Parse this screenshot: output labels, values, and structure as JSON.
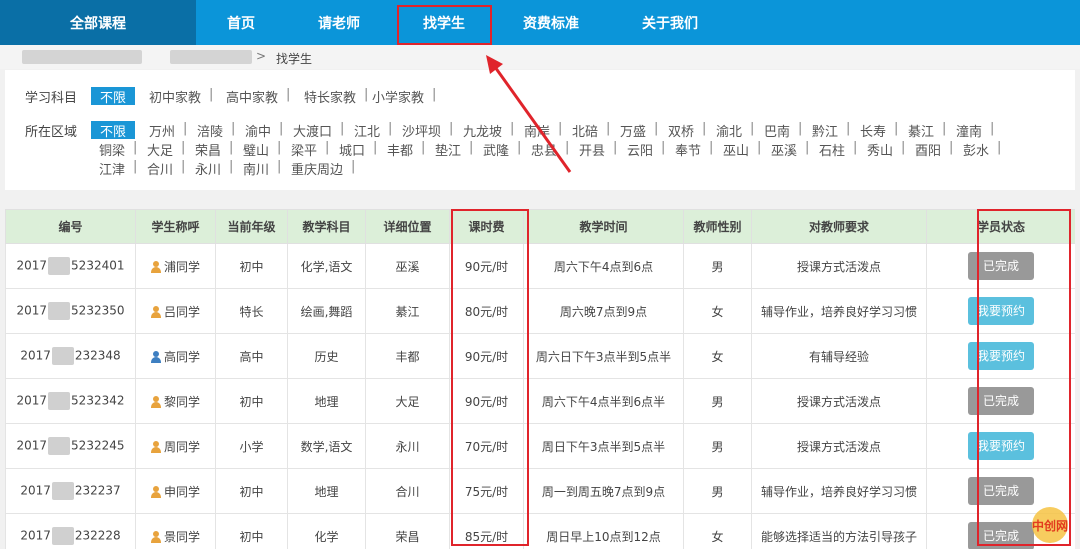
{
  "nav": {
    "all": "全部课程",
    "items": [
      "首页",
      "请老师",
      "找学生",
      "资费标准",
      "关于我们"
    ]
  },
  "breadcrumb": {
    "separator": ">",
    "current": "找学生"
  },
  "filter": {
    "subject_label": "学习科目",
    "all_label": "不限",
    "subjects": [
      "初中家教",
      "高中家教",
      "特长家教",
      "小学家教"
    ],
    "area_label": "所在区域",
    "areas_row1": [
      "万州",
      "涪陵",
      "渝中",
      "大渡口",
      "江北",
      "沙坪坝",
      "九龙坡",
      "南岸",
      "北碚",
      "万盛",
      "双桥",
      "渝北",
      "巴南",
      "黔江",
      "长寿",
      "綦江",
      "潼南"
    ],
    "areas_row2": [
      "铜梁",
      "大足",
      "荣昌",
      "璧山",
      "梁平",
      "城口",
      "丰都",
      "垫江",
      "武隆",
      "忠县",
      "开县",
      "云阳",
      "奉节",
      "巫山",
      "巫溪",
      "石柱",
      "秀山",
      "酉阳",
      "彭水"
    ],
    "areas_row3": [
      "江津",
      "合川",
      "永川",
      "南川",
      "重庆周边"
    ]
  },
  "table": {
    "headers": [
      "编号",
      "学生称呼",
      "当前年级",
      "教学科目",
      "详细位置",
      "课时费",
      "教学时间",
      "教师性别",
      "对教师要求",
      "学员状态"
    ],
    "rows": [
      {
        "id_a": "2017",
        "id_b": "5232401",
        "name": "浦同学",
        "icon_color": "#e8a33d",
        "grade": "初中",
        "subject": "化学,语文",
        "location": "巫溪",
        "fee": "90元/时",
        "time": "周六下午4点到6点",
        "gender": "男",
        "req": "授课方式活泼点",
        "status": "已完成",
        "status_type": "done"
      },
      {
        "id_a": "2017",
        "id_b": "5232350",
        "name": "吕同学",
        "icon_color": "#e8a33d",
        "grade": "特长",
        "subject": "绘画,舞蹈",
        "location": "綦江",
        "fee": "80元/时",
        "time": "周六晚7点到9点",
        "gender": "女",
        "req": "辅导作业，培养良好学习习惯",
        "status": "我要预约",
        "status_type": "book"
      },
      {
        "id_a": "2017",
        "id_b": "232348",
        "name": "高同学",
        "icon_color": "#3e7fc1",
        "grade": "高中",
        "subject": "历史",
        "location": "丰都",
        "fee": "90元/时",
        "time": "周六日下午3点半到5点半",
        "gender": "女",
        "req": "有辅导经验",
        "status": "我要预约",
        "status_type": "book"
      },
      {
        "id_a": "2017",
        "id_b": "5232342",
        "name": "黎同学",
        "icon_color": "#e8a33d",
        "grade": "初中",
        "subject": "地理",
        "location": "大足",
        "fee": "90元/时",
        "time": "周六下午4点半到6点半",
        "gender": "男",
        "req": "授课方式活泼点",
        "status": "已完成",
        "status_type": "done"
      },
      {
        "id_a": "2017",
        "id_b": "5232245",
        "name": "周同学",
        "icon_color": "#e8a33d",
        "grade": "小学",
        "subject": "数学,语文",
        "location": "永川",
        "fee": "70元/时",
        "time": "周日下午3点半到5点半",
        "gender": "男",
        "req": "授课方式活泼点",
        "status": "我要预约",
        "status_type": "book"
      },
      {
        "id_a": "2017",
        "id_b": "232237",
        "name": "申同学",
        "icon_color": "#e8a33d",
        "grade": "初中",
        "subject": "地理",
        "location": "合川",
        "fee": "75元/时",
        "time": "周一到周五晚7点到9点",
        "gender": "男",
        "req": "辅导作业，培养良好学习习惯",
        "status": "已完成",
        "status_type": "done"
      },
      {
        "id_a": "2017",
        "id_b": "232228",
        "name": "景同学",
        "icon_color": "#e8a33d",
        "grade": "初中",
        "subject": "化学",
        "location": "荣昌",
        "fee": "85元/时",
        "time": "周日早上10点到12点",
        "gender": "女",
        "req": "能够选择适当的方法引导孩子",
        "status": "已完成",
        "status_type": "done"
      }
    ]
  },
  "colors": {
    "nav": "#0b95d9",
    "nav_active": "#0a6fa6",
    "highlight": "#e0242b",
    "header_bg": "#dcefd9",
    "book": "#5bc0de",
    "done": "#999999"
  },
  "watermark": "中创网"
}
